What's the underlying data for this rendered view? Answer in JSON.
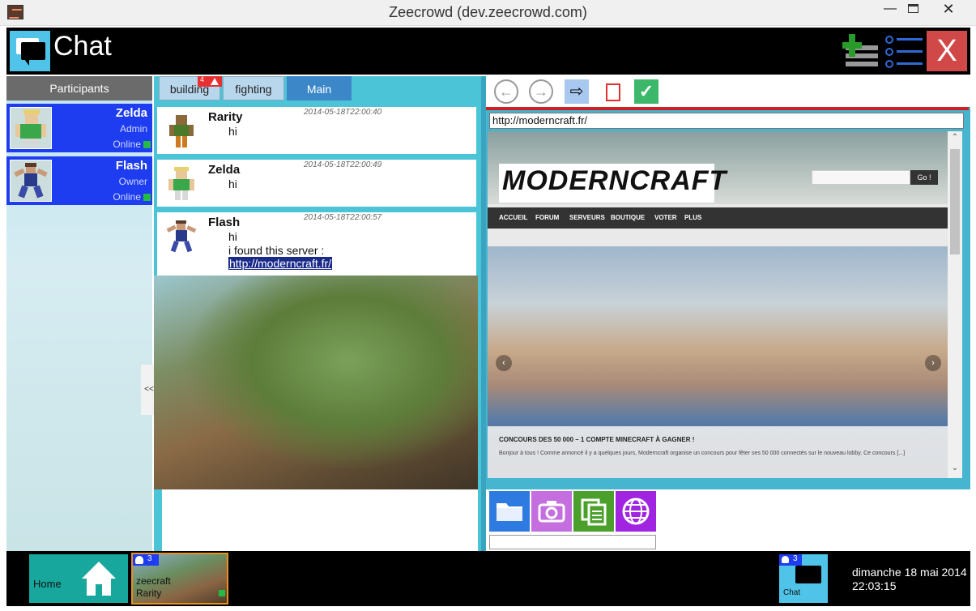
{
  "window": {
    "title": "Zeecrowd (dev.zeecrowd.com)",
    "minimize": "—",
    "close": "✕"
  },
  "header": {
    "title": "Chat",
    "close_label": "X"
  },
  "sidebar": {
    "heading": "Participants",
    "collapse_label": "<<",
    "participants": [
      {
        "name": "Zelda",
        "role": "Admin",
        "status": "Online"
      },
      {
        "name": "Flash",
        "role": "Owner",
        "status": "Online"
      }
    ]
  },
  "tabs": [
    {
      "label": "building",
      "badge": "4"
    },
    {
      "label": "fighting"
    },
    {
      "label": "Main"
    }
  ],
  "messages": [
    {
      "author": "Rarity",
      "time": "2014-05-18T22:00:40",
      "lines": [
        "hi"
      ]
    },
    {
      "author": "Zelda",
      "time": "2014-05-18T22:00:49",
      "lines": [
        "hi"
      ]
    },
    {
      "author": "Flash",
      "time": "2014-05-18T22:00:57",
      "lines": [
        "hi",
        "i found this server :"
      ],
      "link": "http://moderncraft.fr/"
    }
  ],
  "browser": {
    "url": "http://moderncraft.fr/",
    "site": {
      "logo": "MODERNCRAFT",
      "go": "Go !",
      "menu": [
        "ACCUEIL",
        "FORUM",
        "SERVEURS",
        "BOUTIQUE",
        "VOTER",
        "PLUS"
      ],
      "headline": "CONCOURS DES 50 000 – 1 COMPTE MINECRAFT À GAGNER !",
      "excerpt": "Bonjour à tous ! Comme annoncé il y a quelques jours, Moderncraft organise un concours pour fêter ses 50 000 connectés sur le nouveau lobby. Ce concours [...]"
    }
  },
  "taskbar": {
    "home_label": "Home",
    "room": {
      "users": "3",
      "line1": "zeecraft",
      "line2": "Rarity"
    },
    "chat": {
      "users": "3",
      "label": "Chat"
    },
    "date": "dimanche 18 mai 2014",
    "time": "22:03:15"
  },
  "colors": {
    "accent_blue": "#1e3cf0",
    "chat_cyan": "#4fc3e8",
    "close_red": "#d04848",
    "online_green": "#22bb44"
  }
}
